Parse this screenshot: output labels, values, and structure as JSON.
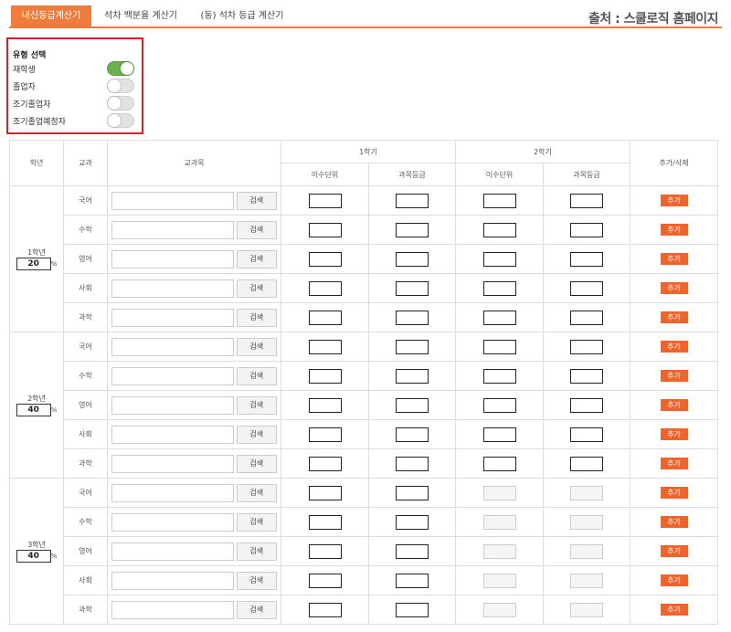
{
  "tabs": [
    {
      "label": "내신등급계산기",
      "active": true
    },
    {
      "label": "석차 백분율 계산기",
      "active": false
    },
    {
      "label": "(동) 석차 등급 계산기",
      "active": false
    }
  ],
  "source": "출처 : 스쿨로직 홈페이지",
  "type_select": {
    "title": "유형 선택",
    "options": [
      {
        "label": "재학생",
        "on": true
      },
      {
        "label": "졸업자",
        "on": false
      },
      {
        "label": "조기졸업자",
        "on": false
      },
      {
        "label": "조기졸업예정자",
        "on": false
      }
    ]
  },
  "table": {
    "headers": {
      "year": "학년",
      "subject": "교과",
      "course": "교과목",
      "sem1": "1학기",
      "sem2": "2학기",
      "units": "이수단위",
      "grade": "과목등급",
      "action": "추가/삭제"
    },
    "search_label": "검색",
    "add_label": "추가",
    "pct_sign": "%",
    "years": [
      {
        "label": "1학년",
        "weight": "20",
        "sem2_disabled": false,
        "subjects": [
          "국어",
          "수학",
          "영어",
          "사회",
          "과학"
        ]
      },
      {
        "label": "2학년",
        "weight": "40",
        "sem2_disabled": false,
        "subjects": [
          "국어",
          "수학",
          "영어",
          "사회",
          "과학"
        ]
      },
      {
        "label": "3학년",
        "weight": "40",
        "sem2_disabled": true,
        "subjects": [
          "국어",
          "수학",
          "영어",
          "사회",
          "과학"
        ]
      }
    ]
  },
  "colors": {
    "accent": "#f07b3a",
    "add_button": "#f0632c",
    "highlight_border": "#d9202a",
    "toggle_on": "#6ab04c"
  }
}
